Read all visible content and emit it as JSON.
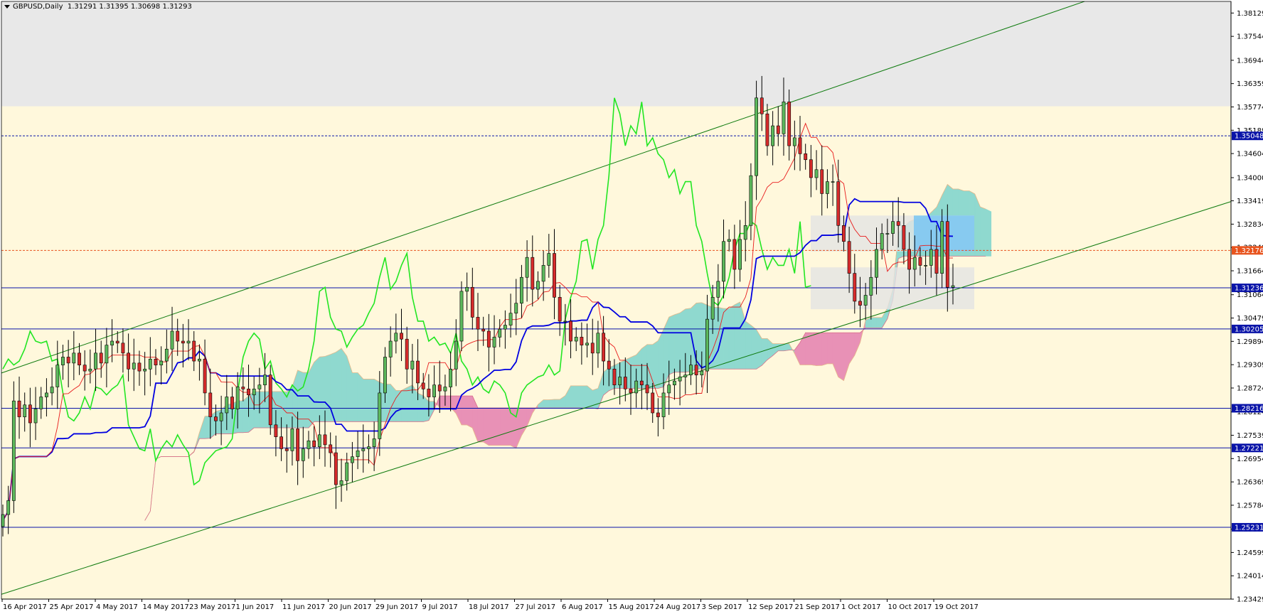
{
  "chart_data": {
    "type": "candlestick",
    "title": "GBPUSD,Daily",
    "ohlc_readout": "1.31291 1.31395 1.30698 1.31293",
    "ylim": [
      1.2343,
      1.3842
    ],
    "y_ticks": [
      "1.38129",
      "1.37544",
      "1.36944",
      "1.36359",
      "1.35774",
      "1.35189",
      "1.34604",
      "1.34000",
      "1.33419",
      "1.32834",
      "1.32249",
      "1.31664",
      "1.31064",
      "1.30479",
      "1.29894",
      "1.29309",
      "1.28724",
      "1.28124",
      "1.27539",
      "1.26954",
      "1.26369",
      "1.25784",
      "1.25184",
      "1.24599",
      "1.24014",
      "1.23429"
    ],
    "x_ticks": [
      "16 Apr 2017",
      "25 Apr 2017",
      "4 May 2017",
      "14 May 2017",
      "23 May 2017",
      "1 Jun 2017",
      "11 Jun 2017",
      "20 Jun 2017",
      "29 Jun 2017",
      "9 Jul 2017",
      "18 Jul 2017",
      "27 Jul 2017",
      "6 Aug 2017",
      "15 Aug 2017",
      "24 Aug 2017",
      "3 Sep 2017",
      "12 Sep 2017",
      "21 Sep 2017",
      "1 Oct 2017",
      "10 Oct 2017",
      "19 Oct 2017"
    ],
    "price_tags": [
      {
        "label": "1.35048",
        "value": 1.35048,
        "color": "#0a14a8"
      },
      {
        "label": "1.32176",
        "value": 1.32176,
        "color": "#e8541e"
      },
      {
        "label": "1.31236",
        "value": 1.31236,
        "color": "#0a14a8"
      },
      {
        "label": "1.30205",
        "value": 1.30205,
        "color": "#0a14a8"
      },
      {
        "label": "1.28216",
        "value": 1.28216,
        "color": "#0a14a8"
      },
      {
        "label": "1.27221",
        "value": 1.27221,
        "color": "#0a14a8"
      },
      {
        "label": "1.25231",
        "value": 1.25231,
        "color": "#0a14a8"
      }
    ],
    "grey_zone_from": 1.3579,
    "candles_close": [
      1.2555,
      1.259,
      1.284,
      1.28,
      1.283,
      1.2785,
      1.282,
      1.285,
      1.286,
      1.2875,
      1.293,
      1.295,
      1.2935,
      1.296,
      1.293,
      1.2915,
      1.292,
      1.296,
      1.2935,
      1.298,
      1.299,
      1.2985,
      1.296,
      1.292,
      1.2935,
      1.2915,
      1.292,
      1.2945,
      1.293,
      1.294,
      1.297,
      1.3015,
      1.299,
      1.2985,
      1.299,
      1.294,
      1.2945,
      1.286,
      1.28,
      1.279,
      1.281,
      1.285,
      1.282,
      1.2875,
      1.287,
      1.2855,
      1.287,
      1.288,
      1.2905,
      1.278,
      1.275,
      1.272,
      1.2715,
      1.277,
      1.269,
      1.272,
      1.274,
      1.2725,
      1.2755,
      1.273,
      1.271,
      1.263,
      1.264,
      1.2685,
      1.27,
      1.2715,
      1.272,
      1.2725,
      1.2745,
      1.286,
      1.295,
      1.299,
      1.301,
      1.2995,
      1.292,
      1.294,
      1.2885,
      1.287,
      1.285,
      1.288,
      1.2865,
      1.2875,
      1.292,
      1.299,
      1.3115,
      1.3125,
      1.305,
      1.302,
      1.3015,
      1.2975,
      1.3,
      1.302,
      1.303,
      1.306,
      1.3085,
      1.315,
      1.32,
      1.312,
      1.314,
      1.318,
      1.321,
      1.31,
      1.304,
      1.304,
      1.299,
      1.3,
      1.298,
      1.2985,
      1.296,
      1.301,
      1.294,
      1.292,
      1.288,
      1.29,
      1.287,
      1.286,
      1.289,
      1.288,
      1.286,
      1.281,
      1.28,
      1.286,
      1.288,
      1.289,
      1.29,
      1.2905,
      1.293,
      1.2905,
      1.2915,
      1.3045,
      1.31,
      1.314,
      1.324,
      1.3245,
      1.317,
      1.3245,
      1.328,
      1.3405,
      1.36,
      1.356,
      1.348,
      1.353,
      1.351,
      1.359,
      1.348,
      1.35,
      1.346,
      1.3445,
      1.34,
      1.342,
      1.336,
      1.339,
      1.339,
      1.328,
      1.324,
      1.316,
      1.309,
      1.308,
      1.3105,
      1.315,
      1.322,
      1.326,
      1.326,
      1.329,
      1.328,
      1.322,
      1.317,
      1.32,
      1.318,
      1.318,
      1.322,
      1.316,
      1.329,
      1.3125,
      1.3129
    ]
  }
}
